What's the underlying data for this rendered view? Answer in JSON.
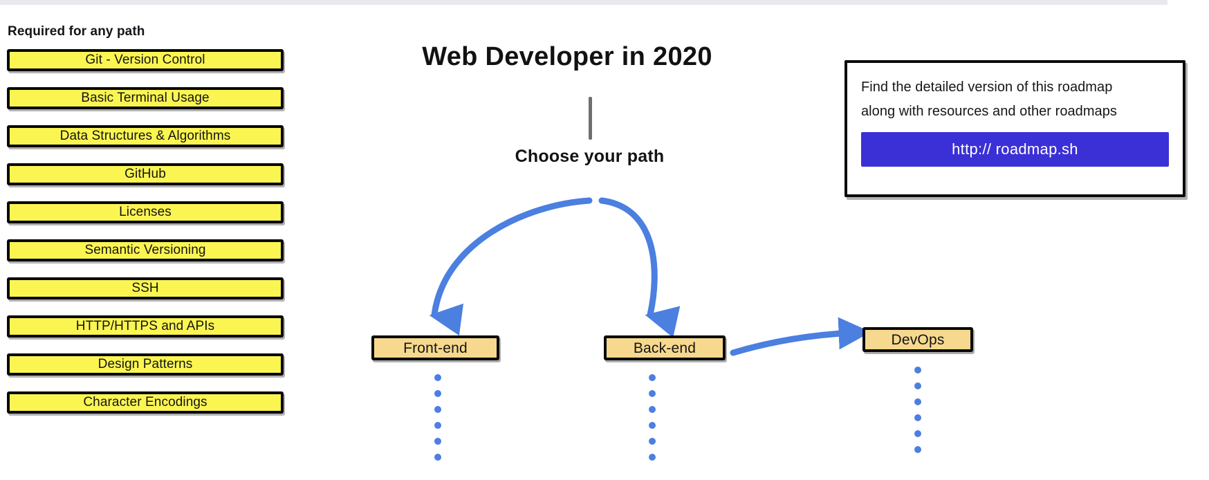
{
  "page": {
    "background_color": "#ffffff",
    "top_strip_color": "#e8e8ed"
  },
  "required_section": {
    "heading": "Required for any path",
    "box_fill_color": "#fbf552",
    "box_border_color": "#080808",
    "items": [
      {
        "label": "Git - Version Control"
      },
      {
        "label": "Basic Terminal Usage"
      },
      {
        "label": "Data Structures & Algorithms"
      },
      {
        "label": "GitHub"
      },
      {
        "label": "Licenses"
      },
      {
        "label": "Semantic Versioning"
      },
      {
        "label": "SSH"
      },
      {
        "label": "HTTP/HTTPS and APIs"
      },
      {
        "label": "Design Patterns"
      },
      {
        "label": "Character Encodings"
      }
    ]
  },
  "center": {
    "title": "Web Developer in 2020",
    "stem_color": "#6f6f6f",
    "choose_path_label": "Choose your path",
    "arrow_color": "#4b7fe0",
    "dot_color": "#4b7fe0",
    "dots_per_trail": 6,
    "path_box_fill_color": "#f6d98e",
    "path_boxes": [
      {
        "label": "Front-end"
      },
      {
        "label": "Back-end"
      },
      {
        "label": "DevOps"
      }
    ]
  },
  "info_card": {
    "line1": "Find the detailed version of this roadmap",
    "line2": "along with resources and other roadmaps",
    "link_label": "http:// roadmap.sh",
    "link_background_color": "#3b30d6",
    "link_text_color": "#ffffff"
  }
}
